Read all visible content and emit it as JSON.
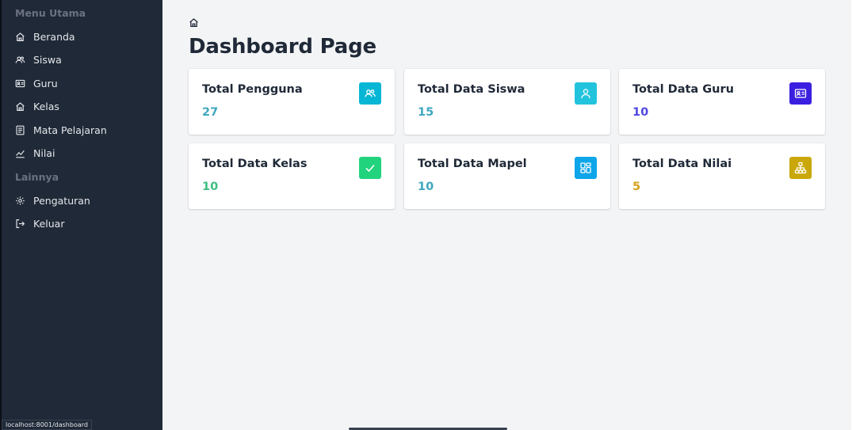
{
  "sidebar": {
    "heading_main": "Menu Utama",
    "heading_other": "Lainnya",
    "items": [
      {
        "label": "Beranda",
        "icon": "home-icon"
      },
      {
        "label": "Siswa",
        "icon": "users-icon"
      },
      {
        "label": "Guru",
        "icon": "id-card-icon"
      },
      {
        "label": "Kelas",
        "icon": "home-icon"
      },
      {
        "label": "Mata Pelajaran",
        "icon": "document-icon"
      },
      {
        "label": "Nilai",
        "icon": "chart-line-icon"
      }
    ],
    "other_items": [
      {
        "label": "Pengaturan",
        "icon": "gear-icon"
      },
      {
        "label": "Keluar",
        "icon": "logout-icon"
      }
    ]
  },
  "main": {
    "breadcrumb_icon": "home-icon",
    "title": "Dashboard Page"
  },
  "cards": [
    {
      "title": "Total Pengguna",
      "value": "27",
      "color": "#06b6d4",
      "value_color": "#3ea7bf",
      "icon": "users-icon"
    },
    {
      "title": "Total Data Siswa",
      "value": "15",
      "color": "#22c3dd",
      "value_color": "#3ea7bf",
      "icon": "user-icon"
    },
    {
      "title": "Total Data Guru",
      "value": "10",
      "color": "#3b1fe0",
      "value_color": "#4f46e5",
      "icon": "id-card-icon"
    },
    {
      "title": "Total Data Kelas",
      "value": "10",
      "color": "#22d37e",
      "value_color": "#3fbf82",
      "icon": "check-icon"
    },
    {
      "title": "Total Data Mapel",
      "value": "10",
      "color": "#0ea5e9",
      "value_color": "#3ea7bf",
      "icon": "grid-icon"
    },
    {
      "title": "Total Data Nilai",
      "value": "5",
      "color": "#caa80b",
      "value_color": "#d4a017",
      "icon": "hierarchy-icon"
    }
  ],
  "status_bar": {
    "url": "localhost:8001/dashboard"
  }
}
